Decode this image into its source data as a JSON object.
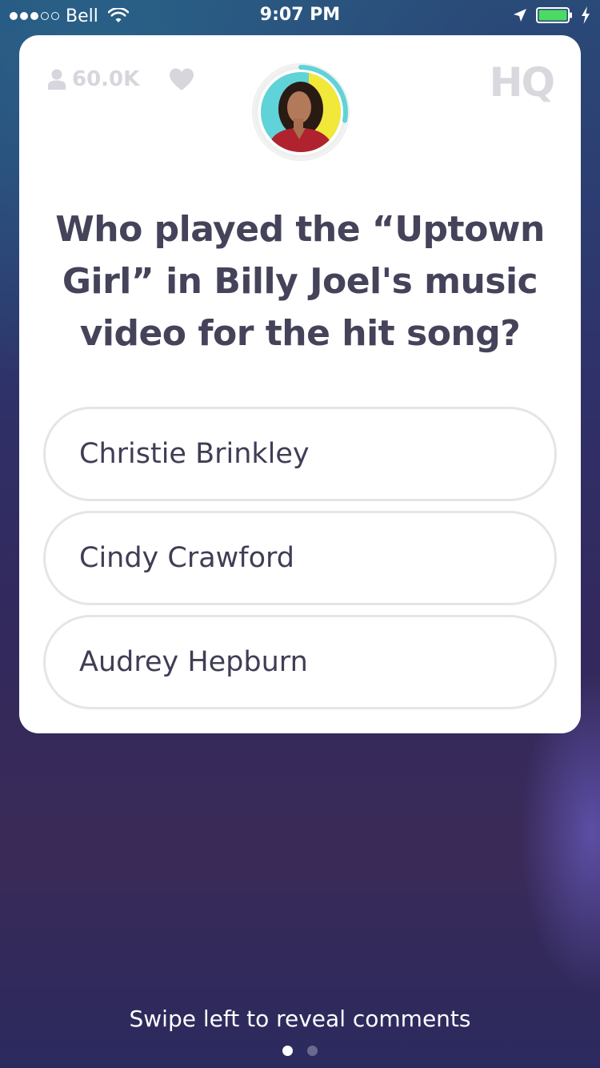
{
  "status_bar": {
    "carrier": "Bell",
    "time": "9:07 PM",
    "signal_dots_full": 3,
    "signal_dots_total": 5,
    "battery_color": "#4cd964"
  },
  "header": {
    "viewer_count": "60.0K",
    "logo": "HQ",
    "timer_progress": 0.28,
    "timer_color": "#5fd3d8"
  },
  "question": {
    "text": "Who played the “Uptown Girl” in Billy Joel's music video for the hit song?"
  },
  "answers": [
    {
      "label": "Christie Brinkley"
    },
    {
      "label": "Cindy Crawford"
    },
    {
      "label": "Audrey Hepburn"
    }
  ],
  "footer": {
    "hint": "Swipe left to reveal comments",
    "page_index": 0,
    "page_count": 2
  },
  "icons": [
    "wifi-icon",
    "location-icon",
    "battery-icon",
    "person-icon",
    "heart-icon"
  ]
}
